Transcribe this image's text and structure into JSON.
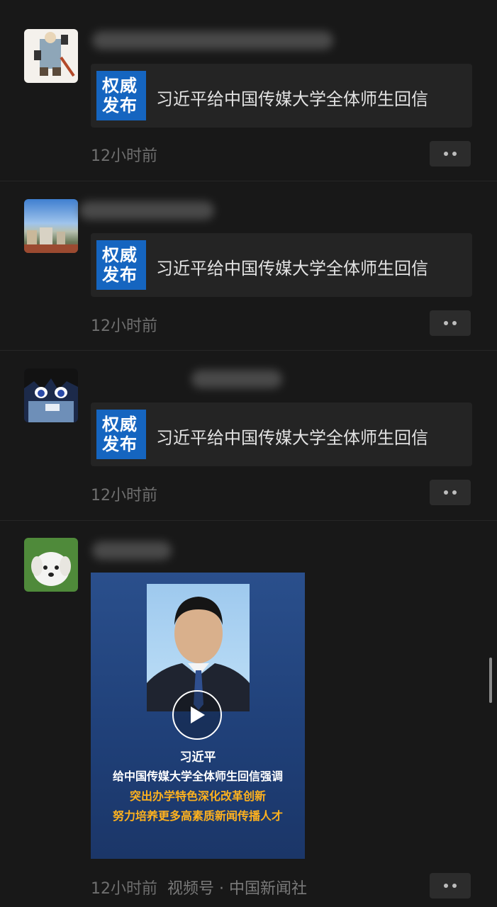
{
  "posts": [
    {
      "link_thumb_line1": "权威",
      "link_thumb_line2": "发布",
      "link_title": "习近平给中国传媒大学全体师生回信",
      "time": "12小时前"
    },
    {
      "link_thumb_line1": "权威",
      "link_thumb_line2": "发布",
      "link_title": "习近平给中国传媒大学全体师生回信",
      "time": "12小时前"
    },
    {
      "link_thumb_line1": "权威",
      "link_thumb_line2": "发布",
      "link_title": "习近平给中国传媒大学全体师生回信",
      "time": "12小时前"
    },
    {
      "time": "12小时前",
      "source": "视频号 · 中国新闻社",
      "video": {
        "line1": "习近平",
        "line2": "给中国传媒大学全体师生回信强调",
        "line3": "突出办学特色深化改革创新",
        "line4": "努力培养更多高素质新闻传播人才"
      }
    }
  ],
  "colors": {
    "background": "#181818",
    "card": "#242424",
    "thumb_blue": "#1565c0",
    "highlight_text": "#ffb21e"
  }
}
